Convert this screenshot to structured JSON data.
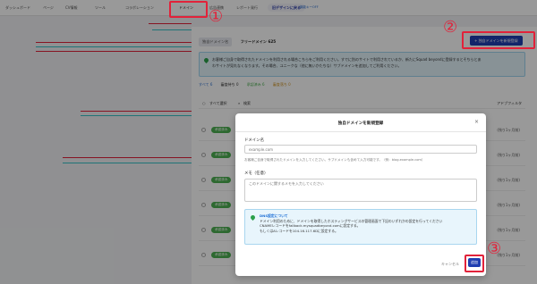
{
  "nav": {
    "items": [
      {
        "label": "ダッシュボード"
      },
      {
        "label": "ページ"
      },
      {
        "label": "CV情報"
      },
      {
        "label": "ツール"
      },
      {
        "label": "コラボレーション"
      },
      {
        "label": "ドメイン"
      },
      {
        "label": "広告連携"
      },
      {
        "label": "レポート発行"
      }
    ],
    "new_design": "旧デザインに戻る",
    "sub_link": "機能キーOFF"
  },
  "annotations": {
    "one": "①",
    "two": "②",
    "three": "③",
    "color": "#e2223a"
  },
  "panel": {
    "tab_label": "独自ドメイン名",
    "free_domain": "フリードメイン 625",
    "add_button": "+ 独自ドメインを新規登録",
    "banner_line1": "お客様ご自身で取得されたドメインを利用される場合こちらをご利用ください。すでに別のサイトで利用されているか、新たにSquad beyondに登録するとそちらとあ",
    "banner_line2": "わサイトが見れなくなります。その場合、ユニークな（他に無いかたちな）サブドメインを追加してご利用ください。",
    "filters": [
      "すべて 6",
      "審査待ち 0",
      "承認済み 6",
      "審査落ち 0"
    ],
    "select_all": "すべて選択",
    "search": "検索",
    "filter": "アドブフィルタ",
    "row_badge": "承認済み",
    "row_expiry": "(残り1ヶ月前)"
  },
  "modal": {
    "title": "独自ドメインを新規登録",
    "close": "×",
    "domain_label": "ドメイン名",
    "domain_placeholder": "example.com",
    "domain_hint": "お客様ご自身で取得されたドメインを入力してください。サブドメインも含めて入力可能です。（例：blog.example.com）",
    "memo_label": "メモ（任意）",
    "memo_placeholder": "このドメインに関するメモを入力してください",
    "dns_title": "DNS設定について",
    "dns_line1": "ドメイン利用のために、ドメインを取得したホスティングサービスの管理画面で下記のいずれかの設定を行ってください",
    "dns_line2": "CNAMEレコードをfallback.mysquadbeyond.comに設定する。",
    "dns_line3": "もしくはAレコードを104.16.117.6Dに設定する。",
    "cancel": "キャンセル",
    "submit": "追加"
  },
  "colors": {
    "primary": "#1f3eb1",
    "success": "#4caf50",
    "info_bg": "#e8f5fc"
  }
}
